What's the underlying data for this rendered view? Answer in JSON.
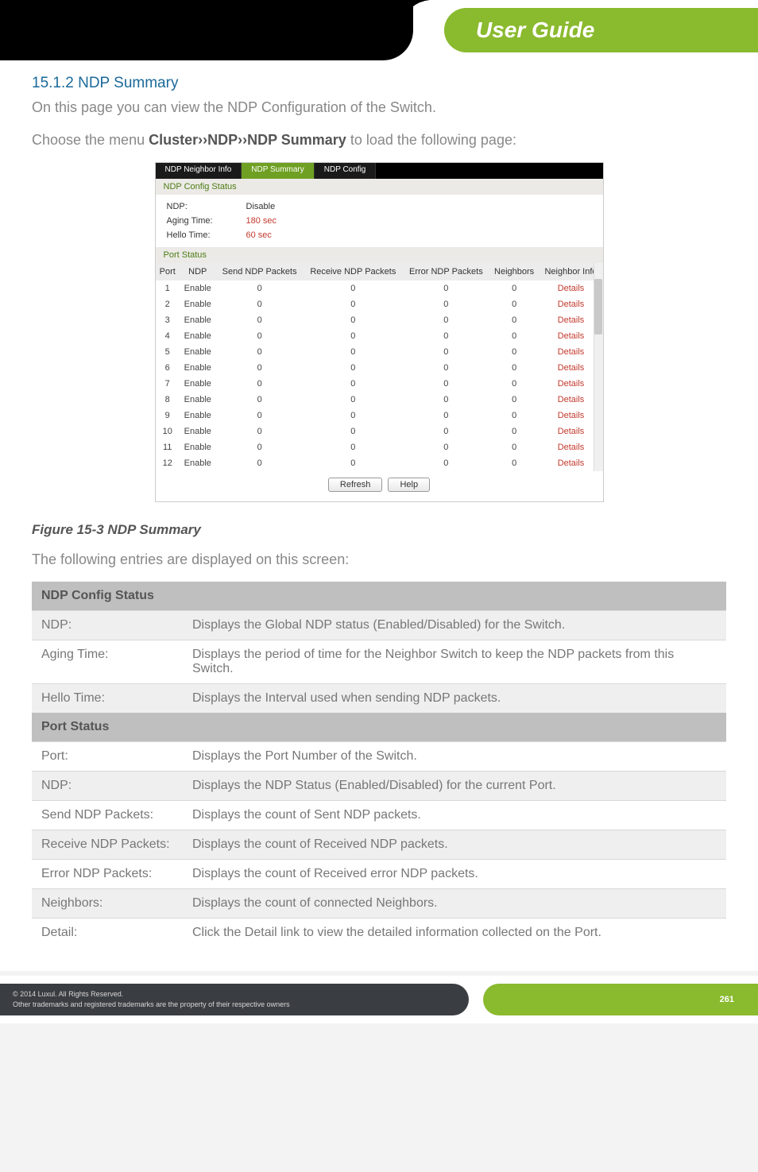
{
  "header": {
    "title": "User Guide"
  },
  "section": {
    "number_title": "15.1.2 NDP Summary",
    "intro": "On this page you can view the NDP Configuration of the Switch.",
    "choose_pre": "Choose the menu ",
    "choose_bold": "Cluster››NDP››NDP Summary",
    "choose_post": " to load the following page:"
  },
  "screenshot": {
    "tabs": [
      "NDP Neighbor Info",
      "NDP Summary",
      "NDP Config"
    ],
    "active_tab": 1,
    "config_status_hdr": "NDP Config Status",
    "config_rows": [
      {
        "k": "NDP:",
        "v": "Disable",
        "cls": "v-disable"
      },
      {
        "k": "Aging Time:",
        "v": "180 sec",
        "cls": "v-red"
      },
      {
        "k": "Hello Time:",
        "v": "60 sec",
        "cls": "v-red"
      }
    ],
    "port_status_hdr": "Port Status",
    "columns": [
      "Port",
      "NDP",
      "Send NDP Packets",
      "Receive NDP Packets",
      "Error NDP Packets",
      "Neighbors",
      "Neighbor Info"
    ],
    "rows": [
      {
        "port": "1",
        "ndp": "Enable",
        "s": "0",
        "r": "0",
        "e": "0",
        "n": "0",
        "link": "Details"
      },
      {
        "port": "2",
        "ndp": "Enable",
        "s": "0",
        "r": "0",
        "e": "0",
        "n": "0",
        "link": "Details"
      },
      {
        "port": "3",
        "ndp": "Enable",
        "s": "0",
        "r": "0",
        "e": "0",
        "n": "0",
        "link": "Details"
      },
      {
        "port": "4",
        "ndp": "Enable",
        "s": "0",
        "r": "0",
        "e": "0",
        "n": "0",
        "link": "Details"
      },
      {
        "port": "5",
        "ndp": "Enable",
        "s": "0",
        "r": "0",
        "e": "0",
        "n": "0",
        "link": "Details"
      },
      {
        "port": "6",
        "ndp": "Enable",
        "s": "0",
        "r": "0",
        "e": "0",
        "n": "0",
        "link": "Details"
      },
      {
        "port": "7",
        "ndp": "Enable",
        "s": "0",
        "r": "0",
        "e": "0",
        "n": "0",
        "link": "Details"
      },
      {
        "port": "8",
        "ndp": "Enable",
        "s": "0",
        "r": "0",
        "e": "0",
        "n": "0",
        "link": "Details"
      },
      {
        "port": "9",
        "ndp": "Enable",
        "s": "0",
        "r": "0",
        "e": "0",
        "n": "0",
        "link": "Details"
      },
      {
        "port": "10",
        "ndp": "Enable",
        "s": "0",
        "r": "0",
        "e": "0",
        "n": "0",
        "link": "Details"
      },
      {
        "port": "11",
        "ndp": "Enable",
        "s": "0",
        "r": "0",
        "e": "0",
        "n": "0",
        "link": "Details"
      },
      {
        "port": "12",
        "ndp": "Enable",
        "s": "0",
        "r": "0",
        "e": "0",
        "n": "0",
        "link": "Details"
      }
    ],
    "buttons": {
      "refresh": "Refresh",
      "help": "Help"
    }
  },
  "figure_caption": "Figure 15-3 NDP Summary",
  "entries_intro": "The following entries are displayed on this screen:",
  "glossary": {
    "hdr1": "NDP Config Status",
    "rows1": [
      {
        "k": "NDP:",
        "v": "Displays the Global NDP status (Enabled/Disabled) for the Switch."
      },
      {
        "k": "Aging Time:",
        "v": "Displays the period of time for the Neighbor Switch to keep the NDP packets from this Switch."
      },
      {
        "k": "Hello Time:",
        "v": "Displays the Interval used when sending NDP packets."
      }
    ],
    "hdr2": "Port Status",
    "rows2": [
      {
        "k": "Port:",
        "v": "Displays the Port Number of the Switch."
      },
      {
        "k": "NDP:",
        "v": "Displays the NDP Status (Enabled/Disabled) for the current Port."
      },
      {
        "k": "Send NDP Packets:",
        "v": "Displays the count of Sent NDP packets."
      },
      {
        "k": "Receive NDP Packets:",
        "v": "Displays the count of Received NDP packets."
      },
      {
        "k": "Error NDP Packets:",
        "v": "Displays the count of Received error NDP packets."
      },
      {
        "k": "Neighbors:",
        "v": "Displays the count of connected Neighbors."
      },
      {
        "k": "Detail:",
        "v": "Click the Detail link to view the detailed information collected on the Port."
      }
    ]
  },
  "footer": {
    "copyright": "© 2014  Luxul. All Rights Reserved.",
    "tm": "Other trademarks and registered trademarks are the property of their respective owners",
    "page": "261"
  }
}
